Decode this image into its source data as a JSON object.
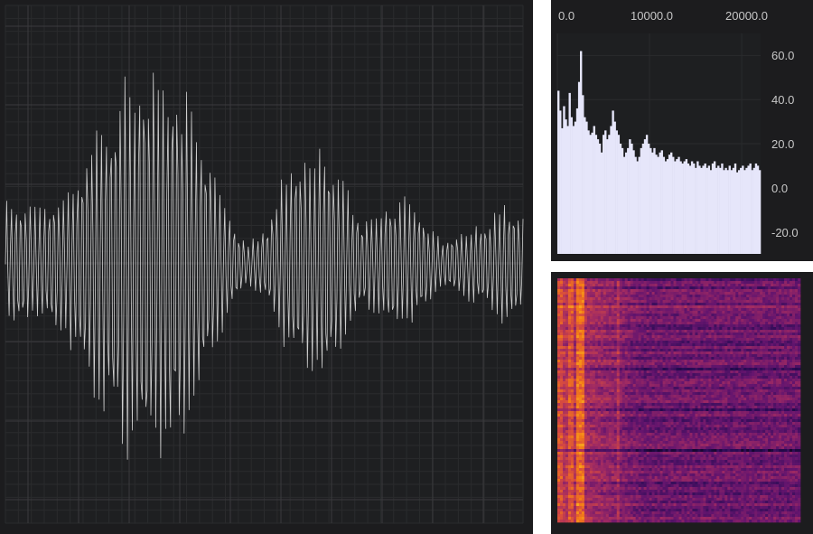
{
  "colors": {
    "panel_background": "#1c1c1e",
    "plot_background": "#1e1f21",
    "grid_major": "#3a3a3d",
    "grid_minor": "#2a2b2d",
    "waveform_line": "#cfcfcf",
    "spectrum_fill": "#e6e6fa",
    "tick_text": "#c8c8c8",
    "separator": "#ffffff"
  },
  "chart_data": [
    {
      "type": "line",
      "grid": true,
      "ylim": [
        -1,
        1
      ],
      "series": [
        {
          "values": [
            0.25,
            0.26,
            0.22,
            0.28,
            0.34,
            0.45,
            0.62,
            0.72,
            0.82,
            0.86,
            0.83,
            0.72,
            0.55,
            0.35,
            0.18,
            0.08,
            0.15,
            0.32,
            0.45,
            0.5,
            0.45,
            0.32,
            0.18,
            0.22,
            0.28,
            0.26,
            0.18,
            0.1,
            0.12,
            0.16,
            0.2,
            0.25,
            0.22
          ]
        }
      ]
    },
    {
      "type": "bar",
      "grid": true,
      "ylim": [
        -30,
        70
      ],
      "xlim": [
        0,
        22050
      ],
      "x_ticks": [
        "0.0",
        "10000.0",
        "20000.0"
      ],
      "y_ticks": [
        "60.0",
        "40.0",
        "20.0",
        "0.0",
        "-20.0"
      ],
      "x_tick_values": [
        0,
        10000,
        20000
      ],
      "y_tick_values": [
        60,
        40,
        20,
        0,
        -20
      ],
      "values": [
        44,
        35,
        27,
        37,
        31,
        28,
        43,
        32,
        28,
        30,
        36,
        48,
        62,
        42,
        32,
        30,
        26,
        24,
        25,
        28,
        24,
        22,
        20,
        16,
        24,
        26,
        22,
        24,
        28,
        35,
        30,
        26,
        24,
        20,
        18,
        14,
        16,
        18,
        22,
        20,
        17,
        14,
        12,
        14,
        18,
        20,
        22,
        24,
        20,
        18,
        16,
        18,
        15,
        14,
        16,
        17,
        14,
        12,
        13,
        15,
        16,
        14,
        12,
        13,
        14,
        12,
        11,
        12,
        13,
        11,
        10,
        12,
        11,
        9,
        12,
        10,
        9,
        10,
        11,
        9,
        10,
        8,
        11,
        12,
        9,
        10,
        9,
        11,
        8,
        9,
        8,
        10,
        8,
        9,
        11,
        7,
        8,
        9,
        10,
        8,
        9,
        10,
        11,
        8,
        9,
        11,
        10,
        8
      ]
    },
    {
      "type": "heatmap",
      "colormap": "inferno"
    }
  ]
}
